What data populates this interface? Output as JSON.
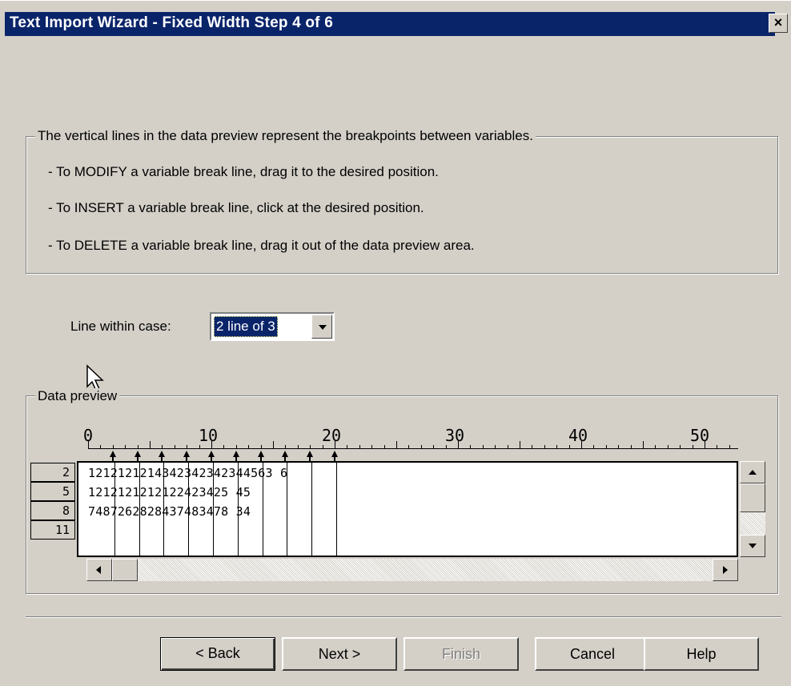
{
  "window": {
    "title": "Text Import Wizard - Fixed Width Step 4 of 6",
    "close_glyph": "×"
  },
  "info": {
    "heading": "The vertical lines in the data preview represent the breakpoints between variables.",
    "lines": [
      "- To MODIFY a variable break line, drag it to the desired position.",
      "- To INSERT a variable break line, click at the desired position.",
      "- To DELETE a variable break line, drag it out of the data preview area."
    ]
  },
  "line_within_case": {
    "label": "Line within case:",
    "value": "2 line of 3"
  },
  "data_preview": {
    "label": "Data preview",
    "ruler_labels": [
      "0",
      "10",
      "20",
      "30",
      "40",
      "50"
    ],
    "row_numbers": [
      "2",
      "5",
      "8",
      "11"
    ],
    "rows": [
      "1212121214342342342344563 6",
      "1212121212122423425 45",
      "7487262828437483478 34"
    ],
    "breakpoints": [
      2,
      4,
      6,
      8,
      10,
      12,
      14,
      16,
      18,
      20
    ]
  },
  "buttons": {
    "back": "< Back",
    "next": "Next >",
    "finish": "Finish",
    "cancel": "Cancel",
    "help": "Help"
  },
  "icons": {
    "close": "close-icon",
    "dropdown": "chevron-down-icon",
    "cursor": "mouse-pointer-icon"
  },
  "colors": {
    "titlebar": "#0a246a",
    "dialog": "#d4d0c8",
    "selection": "#0a246a"
  }
}
